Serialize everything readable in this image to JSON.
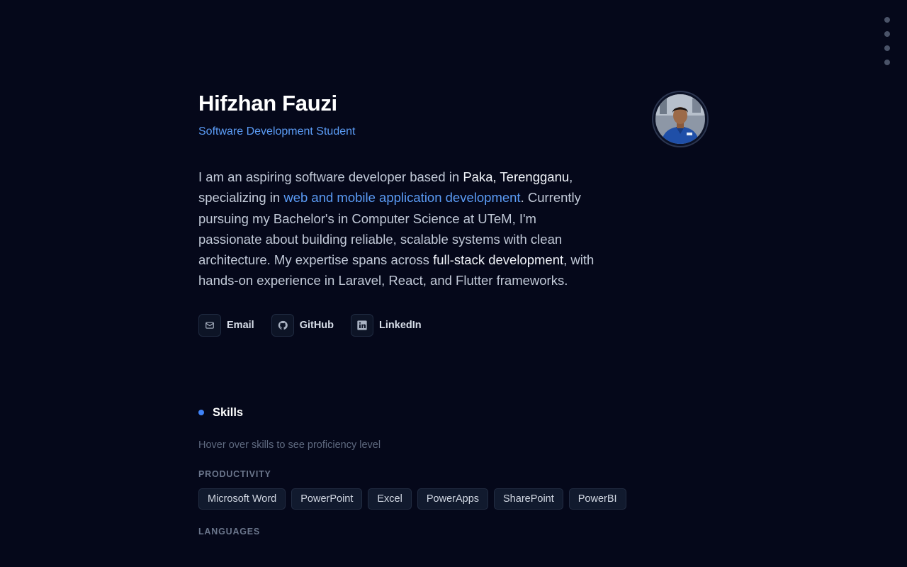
{
  "profile": {
    "name": "Hifzhan Fauzi",
    "role": "Software Development Student"
  },
  "bio": {
    "p1": "I am an aspiring software developer based in ",
    "location": "Paka, Terengganu",
    "p2": ", specializing in ",
    "focus": "web and mobile application development",
    "p3": ". Currently pursuing my Bachelor's in Computer Science at UTeM, I'm passionate about building reliable, scalable systems with clean architecture. My expertise spans across ",
    "expertise": "full-stack development",
    "p4": ", with hands-on experience in Laravel, React, and Flutter frameworks."
  },
  "socials": [
    {
      "label": "Email",
      "icon": "mail-icon"
    },
    {
      "label": "GitHub",
      "icon": "github-icon"
    },
    {
      "label": "LinkedIn",
      "icon": "linkedin-icon"
    }
  ],
  "skills": {
    "title": "Skills",
    "hint": "Hover over skills to see proficiency level",
    "categories": [
      {
        "label": "PRODUCTIVITY",
        "items": [
          "Microsoft Word",
          "PowerPoint",
          "Excel",
          "PowerApps",
          "SharePoint",
          "PowerBI"
        ]
      },
      {
        "label": "LANGUAGES",
        "items": []
      }
    ]
  },
  "colors": {
    "background": "#05081a",
    "accent": "#5b9cf6",
    "bullet": "#3f83f8"
  }
}
